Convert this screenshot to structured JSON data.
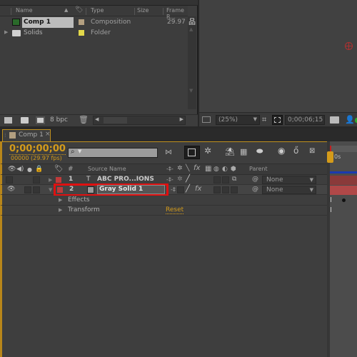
{
  "project": {
    "columns": {
      "name": "Name",
      "type": "Type",
      "size": "Size",
      "frame_rate": "Frame R..."
    },
    "items": [
      {
        "name": "Comp 1",
        "type": "Composition",
        "frame_rate": "29.97",
        "label_color": "#b39f80",
        "icon": "composition-icon",
        "selected": true
      },
      {
        "name": "Solids",
        "type": "Folder",
        "frame_rate": "",
        "label_color": "#e2d84a",
        "icon": "folder-icon",
        "selected": false
      }
    ],
    "footer": {
      "bpc": "8 bpc"
    }
  },
  "viewer": {
    "zoom": "(25%)",
    "timecode": "0;00;06;15"
  },
  "timeline": {
    "tab_label": "Comp 1",
    "current_time": "0;00;00;00",
    "frame_info": "00000 (29.97 fps)",
    "search_placeholder": "",
    "ruler_label": "0s",
    "headers": {
      "number": "#",
      "source_name": "Source Name",
      "parent": "Parent"
    },
    "layers": [
      {
        "number": "1",
        "name": "ABC PRO...IONS",
        "type_icon": "T",
        "label_color": "#c03a3a",
        "parent": "None",
        "selected": false
      },
      {
        "number": "2",
        "name": "Gray Solid 1",
        "type_icon": "solid",
        "label_color": "#c03a3a",
        "parent": "None",
        "selected": true
      }
    ],
    "properties": [
      {
        "name": "Effects"
      },
      {
        "name": "Transform",
        "action": "Reset"
      }
    ],
    "accent_color": "#d49b1a",
    "highlight_color": "#e01010"
  }
}
